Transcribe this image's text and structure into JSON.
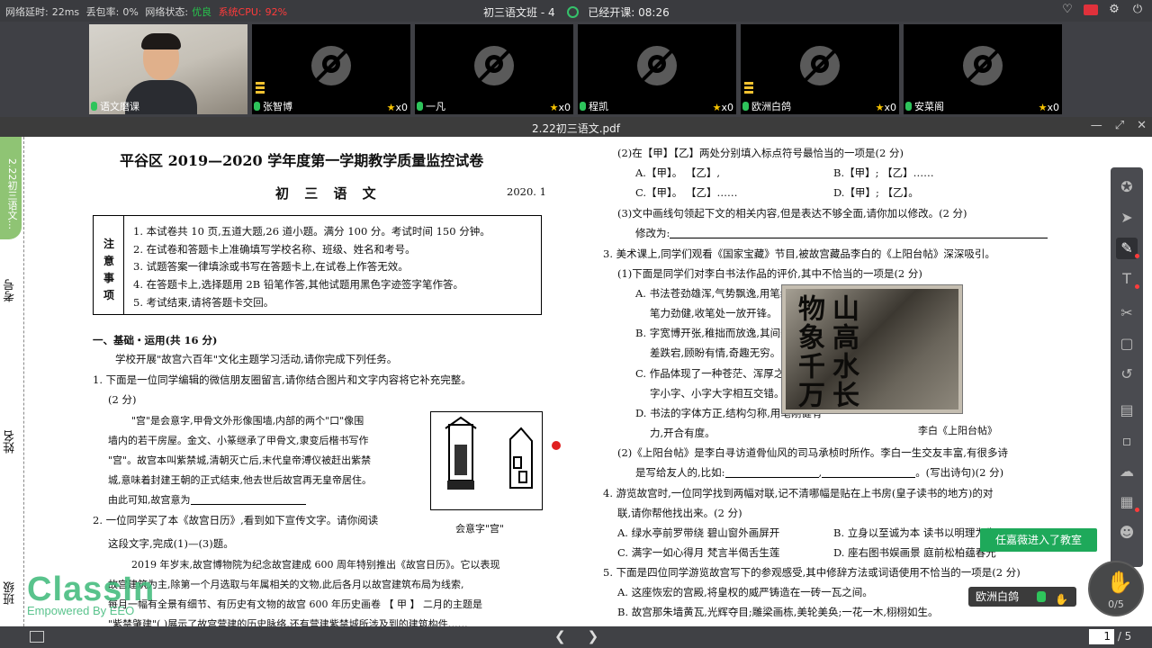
{
  "topbar": {
    "latency_label": "网络延时:",
    "latency": "22ms",
    "loss_label": "丢包率:",
    "loss": "0%",
    "net_label": "网络状态:",
    "net": "优良",
    "cpu_label": "系统CPU:",
    "cpu": "92%",
    "class_title": "初三语文班 - 4",
    "started_label": "已经开课:",
    "elapsed": "08:26"
  },
  "videos": [
    {
      "name": "语文磨课",
      "type": "teacher"
    },
    {
      "name": "张智博",
      "trophies": "x0"
    },
    {
      "name": "一凡",
      "trophies": "x0"
    },
    {
      "name": "程凯",
      "trophies": "x0"
    },
    {
      "name": "欧洲白鸽",
      "trophies": "x0"
    },
    {
      "name": "安菜阁",
      "trophies": "x0"
    }
  ],
  "document": {
    "filename": "2.22初三语文.pdf",
    "side_tab": "2.22初三语文...",
    "side_labels": {
      "exam_no": "考号",
      "name": "姓名",
      "class": "班级"
    },
    "title": "平谷区 2019—2020 学年度第一学期教学质量监控试卷",
    "subject": "初 三 语 文",
    "date": "2020. 1",
    "notice_tag": "注意事项",
    "notices": [
      "1. 本试卷共 10 页,五道大题,26 道小题。满分 100 分。考试时间 150 分钟。",
      "2. 在试卷和答题卡上准确填写学校名称、班级、姓名和考号。",
      "3. 试题答案一律填涂或书写在答题卡上,在试卷上作答无效。",
      "4. 在答题卡上,选择题用 2B 铅笔作答,其他试题用黑色字迹签字笔作答。",
      "5. 考试结束,请将答题卡交回。"
    ],
    "section1": "一、基础・运用(共 16 分)",
    "intro": "学校开展\"故宫六百年\"文化主题学习活动,请你完成下列任务。",
    "q1a": "1. 下面是一位同学编辑的微信朋友圈留言,请你结合图片和文字内容将它补充完整。",
    "q1b": "(2 分)",
    "q1_text": [
      "\"宫\"是会意字,甲骨文外形像围墙,内部的两个\"口\"像围",
      "墙内的若干房屋。金文、小篆继承了甲骨文,隶变后楷书写作",
      "\"宫\"。故宫本叫紫禁城,清朝灭亡后,末代皇帝溥仪被赶出紫禁",
      "城,意味着封建王朝的正式结束,他去世后故宫再无皇帝居住。",
      "由此可知,故宫意为"
    ],
    "palace_caption": "会意字\"宫\"",
    "q2a": "2. 一位同学买了本《故宫日历》,看到如下宣传文字。请你阅读",
    "q2b": "这段文字,完成(1)—(3)题。",
    "q2_text": [
      "2019 年岁末,故宫博物院为纪念故宫建成 600 周年特别推出《故宫日历》。它以表现",
      "故宫建筑为主,除第一个月选取与年属相关的文物,此后各月以故宫建筑布局为线索,",
      "每月一幅有全景有细节、有历史有文物的故宫 600 年历史画卷 【 甲 】 二月的主题是",
      "\"紫禁肇建\"( )展示了故宫营建的历史脉络,还有营建紫禁城所涉及到的建筑构件……"
    ],
    "right_col": [
      "(2)在【甲】【乙】两处分别填入标点符号最恰当的一项是(2 分)",
      "A.【甲】。 【乙】,",
      "B.【甲】; 【乙】……",
      "C.【甲】。 【乙】……",
      "D.【甲】; 【乙】。",
      "(3)文中画线句领起下文的相关内容,但是表达不够全面,请你加以修改。(2 分)",
      "修改为:",
      "3. 美术课上,同学们观看《国家宝藏》节目,被故宫藏品李白的《上阳台帖》深深吸引。",
      "(1)下面是同学们对李白书法作品的评价,其中不恰当的一项是(2 分)",
      "A. 书法苍劲雄浑,气势飘逸,用笔纵放自如,",
      "笔力劲健,收笔处一放开锋。",
      "B. 字宽博开张,稚拙而放逸,其间架结构参",
      "差跌宕,顾盼有情,奇趣无穷。",
      "C. 作品体现了一种苍茫、浑厚之感,文中大",
      "字小字、小字大字相互交错。",
      "D. 书法的字体方正,结构匀称,用笔刚健有",
      "力,开合有度。",
      "(2)《上阳台帖》是李白寻访道骨仙风的司马承桢时所作。李白一生交友丰富,有很多诗",
      "是写给友人的,比如:",
      "。(写出诗句)(2 分)",
      "4. 游览故宫时,一位同学找到两幅对联,记不清哪幅是贴在上书房(皇子读书的地方)的对",
      "联,请你帮他找出来。(2 分)",
      "A. 绿水亭前罗带绕   碧山窗外画屏开",
      "B. 立身以至诚为本   读书以明理为先",
      "C. 满字一如心得月   梵言半偈舌生莲",
      "D. 座右图书娱画景   庭前松柏蕴春光",
      "5. 下面是四位同学游览故宫写下的参观感受,其中修辞方法或词语使用不恰当的一项是(2 分)",
      "A. 这座恢宏的宫殿,将皇权的威严铸造在一砖一瓦之间。",
      "B. 故宫那朱墙黄瓦,光辉夺目;雕梁画栋,美轮美奂;一花一木,栩栩如生。"
    ],
    "callig_chars": "山高水长物象千万",
    "callig_caption": "李白《上阳台帖》"
  },
  "overlays": {
    "toast": "任嘉薇进入了教室",
    "student_name": "欧洲白鸽",
    "hand_count": "0/5",
    "watermark_1": "ClassIn",
    "watermark_2": "Empowered By EEO"
  },
  "pager": {
    "current": "1",
    "total": "/ 5"
  }
}
